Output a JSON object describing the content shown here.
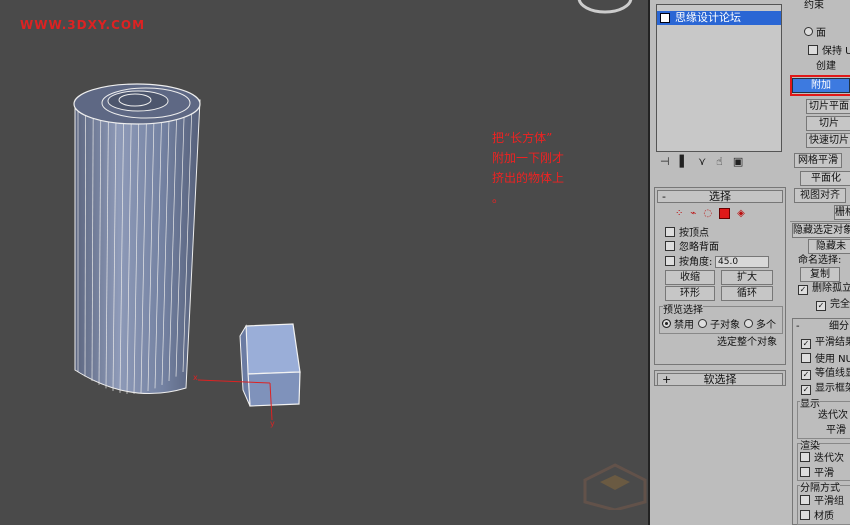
{
  "watermark": "WWW.3DXY.COM",
  "annotation": "把“长方体”\n附加一下刚才\n挤出的物体上\n。",
  "list": {
    "item_label": "思缘设计论坛"
  },
  "toolbar_icons": [
    "pin-icon",
    "stack-icon",
    "funnel-icon",
    "hand-icon",
    "config-icon"
  ],
  "selection_rollout": {
    "sign": "-",
    "title": "选择",
    "by_vertex": "按顶点",
    "ignore_backfacing": "忽略背面",
    "by_angle": "按角度:",
    "angle_value": "45.0",
    "shrink": "收缩",
    "grow": "扩大",
    "ring": "环形",
    "loop": "循环",
    "preview_group": "预览选择",
    "preview_options": [
      "禁用",
      "子对象",
      "多个"
    ],
    "preview_selected_index": 0,
    "whole_object": "选定整个对象"
  },
  "soft_selection_rollout": {
    "sign": "+",
    "title": "软选择"
  },
  "right_column": {
    "constraints": "约束",
    "face": "面",
    "preserve_uv": "保持 UV",
    "create": "创建",
    "attach": "附加",
    "slice_plane": "切片平面",
    "slice": "切片",
    "quick_slice": "快速切片",
    "meshsmooth": "网格平滑",
    "planarize": "平面化",
    "view_align": "视图对齐",
    "grid_align": "栅格",
    "hide_selected": "隐藏选定对象",
    "hide_unselected": "隐藏未",
    "named_selections": "命名选择:",
    "copy": "复制",
    "delete_isolated": "删除孤立",
    "full_interactivity": "完全",
    "subdivision_sign": "-",
    "subdivision": "细分",
    "smooth_result": "平滑结果",
    "use_nurms": "使用 NUR",
    "isoline_display": "等值线显",
    "show_cage": "显示框架",
    "display": "显示",
    "iterations": "迭代次",
    "smoothness": "平滑",
    "render": "渲染",
    "render_iterations": "迭代次",
    "render_smoothness": "平滑",
    "separate_by": "分隔方式",
    "smoothing_groups": "平滑组",
    "materials": "材质"
  },
  "colors": {
    "highlight_box": "#e01818",
    "arrow": "#cc1111",
    "attach_button": "#3d7ae0",
    "list_selection": "#2a66d4"
  }
}
